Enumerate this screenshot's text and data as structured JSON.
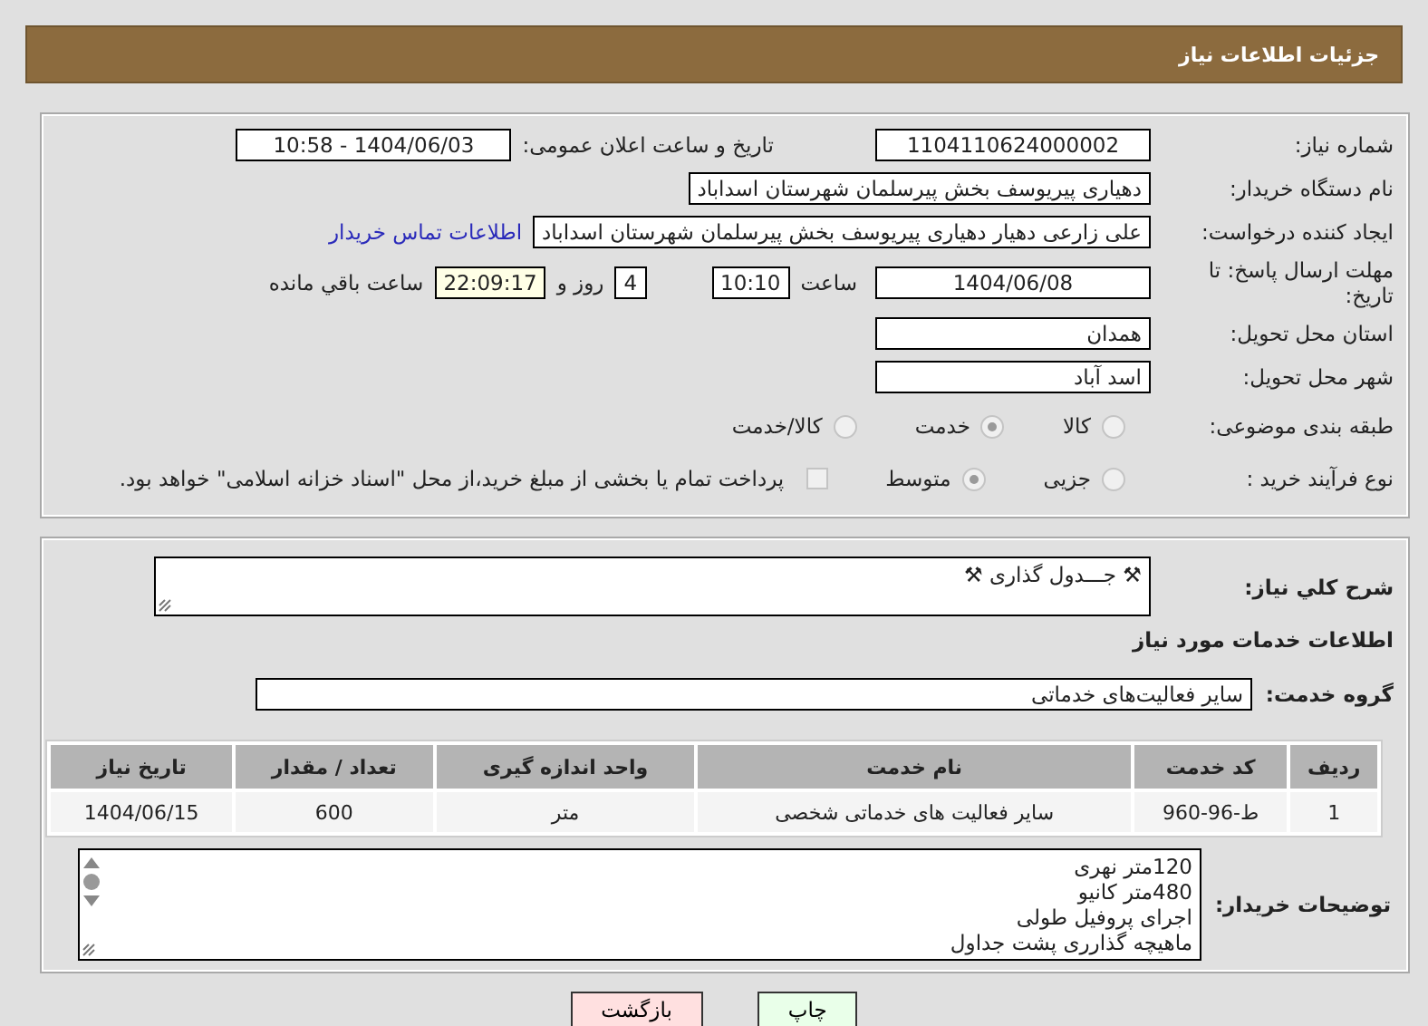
{
  "header": {
    "title": "جزئیات اطلاعات نیاز"
  },
  "need_number": {
    "label": "شماره نیاز:",
    "value": "1104110624000002"
  },
  "announce": {
    "label": "تاریخ و ساعت اعلان عمومی:",
    "value": "1404/06/03 - 10:58"
  },
  "buyer": {
    "label": "نام دستگاه خریدار:",
    "value": "دهیاری پیریوسف بخش پیرسلمان شهرستان اسداباد"
  },
  "requester": {
    "label": "ایجاد کننده درخواست:",
    "value": "علی زارعی دهیار دهیاری پیریوسف بخش پیرسلمان شهرستان اسداباد",
    "link": "اطلاعات تماس خریدار"
  },
  "deadline": {
    "label": "مهلت ارسال پاسخ: تا تاریخ:",
    "date": "1404/06/08",
    "time_label": "ساعت",
    "time": "10:10",
    "days": "4",
    "days_label": "روز و",
    "remaining": "22:09:17",
    "remaining_label": "ساعت باقي مانده"
  },
  "province": {
    "label": "استان محل تحویل:",
    "value": "همدان"
  },
  "city": {
    "label": "شهر محل تحویل:",
    "value": "اسد آباد"
  },
  "category": {
    "label": "طبقه بندی موضوعی:",
    "options": [
      {
        "label": "کالا",
        "selected": false
      },
      {
        "label": "خدمت",
        "selected": true
      },
      {
        "label": "کالا/خدمت",
        "selected": false
      }
    ]
  },
  "process": {
    "label": "نوع فرآیند خرید :",
    "options": [
      {
        "label": "جزیی",
        "selected": false
      },
      {
        "label": "متوسط",
        "selected": true
      }
    ],
    "payment": {
      "checked": false,
      "label": "پرداخت تمام یا بخشی از مبلغ خرید،از محل \"اسناد خزانه اسلامی\" خواهد بود."
    }
  },
  "description": {
    "label": "شرح كلي نياز:",
    "value": "⚒ جـــدول گذاری ⚒"
  },
  "services_title": "اطلاعات خدمات مورد نیاز",
  "service_group": {
    "label": "گروه خدمت:",
    "value": "سایر فعالیت‌های خدماتی"
  },
  "table": {
    "columns": [
      "ردیف",
      "کد خدمت",
      "نام خدمت",
      "واحد اندازه گیری",
      "تعداد / مقدار",
      "تاریخ نیاز"
    ],
    "rows": [
      [
        "1",
        "ط-96-960",
        "سایر فعالیت های خدماتی شخصی",
        "متر",
        "600",
        "1404/06/15"
      ]
    ]
  },
  "buyer_notes": {
    "label": "توضیحات خریدار:",
    "lines": [
      "120متر نهری",
      "480متر کانیو",
      "اجرای پروفیل طولی",
      "ماهیچه گذارری پشت جداول"
    ]
  },
  "buttons": [
    {
      "label": "چاپ",
      "kind": "print"
    },
    {
      "label": "بازگشت",
      "kind": "back"
    }
  ]
}
